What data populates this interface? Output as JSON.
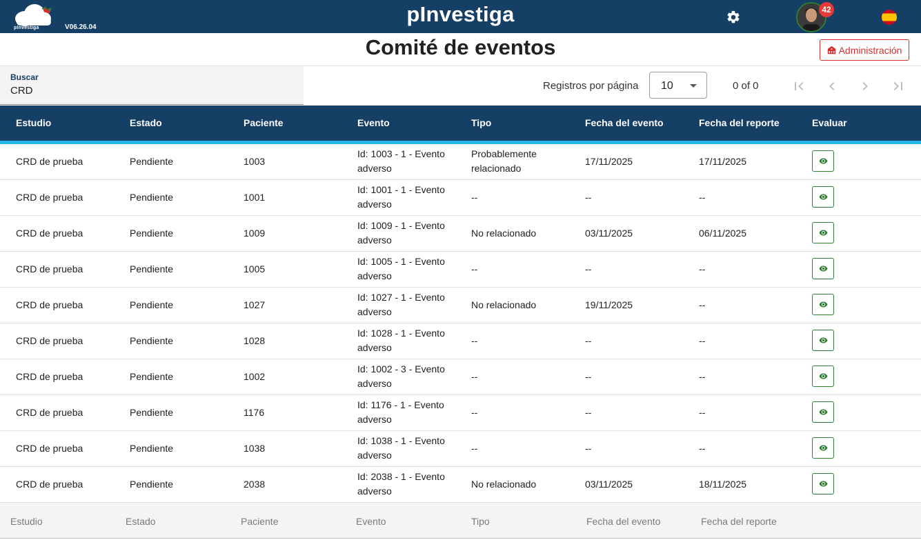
{
  "topbar": {
    "logo_text": "pInvestiga",
    "version": "V06.26.04",
    "brand": "pInvestiga",
    "notifications_count": "42",
    "settings_icon": "gear-icon",
    "language_icon": "spain-flag-icon"
  },
  "header": {
    "title": "Comité de eventos",
    "admin_label": "Administración",
    "admin_icon": "building-icon"
  },
  "search": {
    "label": "Buscar",
    "value": "CRD"
  },
  "pagination": {
    "rows_per_page_label": "Registros por página",
    "rows_per_page_value": "10",
    "range_text": "0 of 0"
  },
  "table": {
    "columns": [
      "Estudio",
      "Estado",
      "Paciente",
      "Evento",
      "Tipo",
      "Fecha del evento",
      "Fecha del reporte",
      "Evaluar"
    ],
    "rows": [
      {
        "estudio": "CRD de prueba",
        "estado": "Pendiente",
        "paciente": "1003",
        "evento": "Id: 1003 - 1 - Evento adverso",
        "tipo": "Probablemente relacionado",
        "fecha_evento": "17/11/2025",
        "fecha_reporte": "17/11/2025"
      },
      {
        "estudio": "CRD de prueba",
        "estado": "Pendiente",
        "paciente": "1001",
        "evento": "Id: 1001 - 1 - Evento adverso",
        "tipo": "--",
        "fecha_evento": "--",
        "fecha_reporte": "--"
      },
      {
        "estudio": "CRD de prueba",
        "estado": "Pendiente",
        "paciente": "1009",
        "evento": "Id: 1009 - 1 - Evento adverso",
        "tipo": "No relacionado",
        "fecha_evento": "03/11/2025",
        "fecha_reporte": "06/11/2025"
      },
      {
        "estudio": "CRD de prueba",
        "estado": "Pendiente",
        "paciente": "1005",
        "evento": "Id: 1005 - 1 - Evento adverso",
        "tipo": "--",
        "fecha_evento": "--",
        "fecha_reporte": "--"
      },
      {
        "estudio": "CRD de prueba",
        "estado": "Pendiente",
        "paciente": "1027",
        "evento": "Id: 1027 - 1 - Evento adverso",
        "tipo": "No relacionado",
        "fecha_evento": "19/11/2025",
        "fecha_reporte": "--"
      },
      {
        "estudio": "CRD de prueba",
        "estado": "Pendiente",
        "paciente": "1028",
        "evento": "Id: 1028 - 1 - Evento adverso",
        "tipo": "--",
        "fecha_evento": "--",
        "fecha_reporte": "--"
      },
      {
        "estudio": "CRD de prueba",
        "estado": "Pendiente",
        "paciente": "1002",
        "evento": "Id: 1002 - 3 - Evento adverso",
        "tipo": "--",
        "fecha_evento": "--",
        "fecha_reporte": "--"
      },
      {
        "estudio": "CRD de prueba",
        "estado": "Pendiente",
        "paciente": "1176",
        "evento": "Id: 1176 - 1 - Evento adverso",
        "tipo": "--",
        "fecha_evento": "--",
        "fecha_reporte": "--"
      },
      {
        "estudio": "CRD de prueba",
        "estado": "Pendiente",
        "paciente": "1038",
        "evento": "Id: 1038 - 1 - Evento adverso",
        "tipo": "--",
        "fecha_evento": "--",
        "fecha_reporte": "--"
      },
      {
        "estudio": "CRD de prueba",
        "estado": "Pendiente",
        "paciente": "2038",
        "evento": "Id: 2038 - 1 - Evento adverso",
        "tipo": "No relacionado",
        "fecha_evento": "03/11/2025",
        "fecha_reporte": "18/11/2025"
      }
    ],
    "footer_columns": [
      "Estudio",
      "Estado",
      "Paciente",
      "Evento",
      "Tipo",
      "Fecha del evento",
      "Fecha del reporte"
    ]
  },
  "colors": {
    "primary": "#163f66",
    "accent": "#29b6e6",
    "danger": "#d32f2f",
    "success": "#2e7d32"
  }
}
